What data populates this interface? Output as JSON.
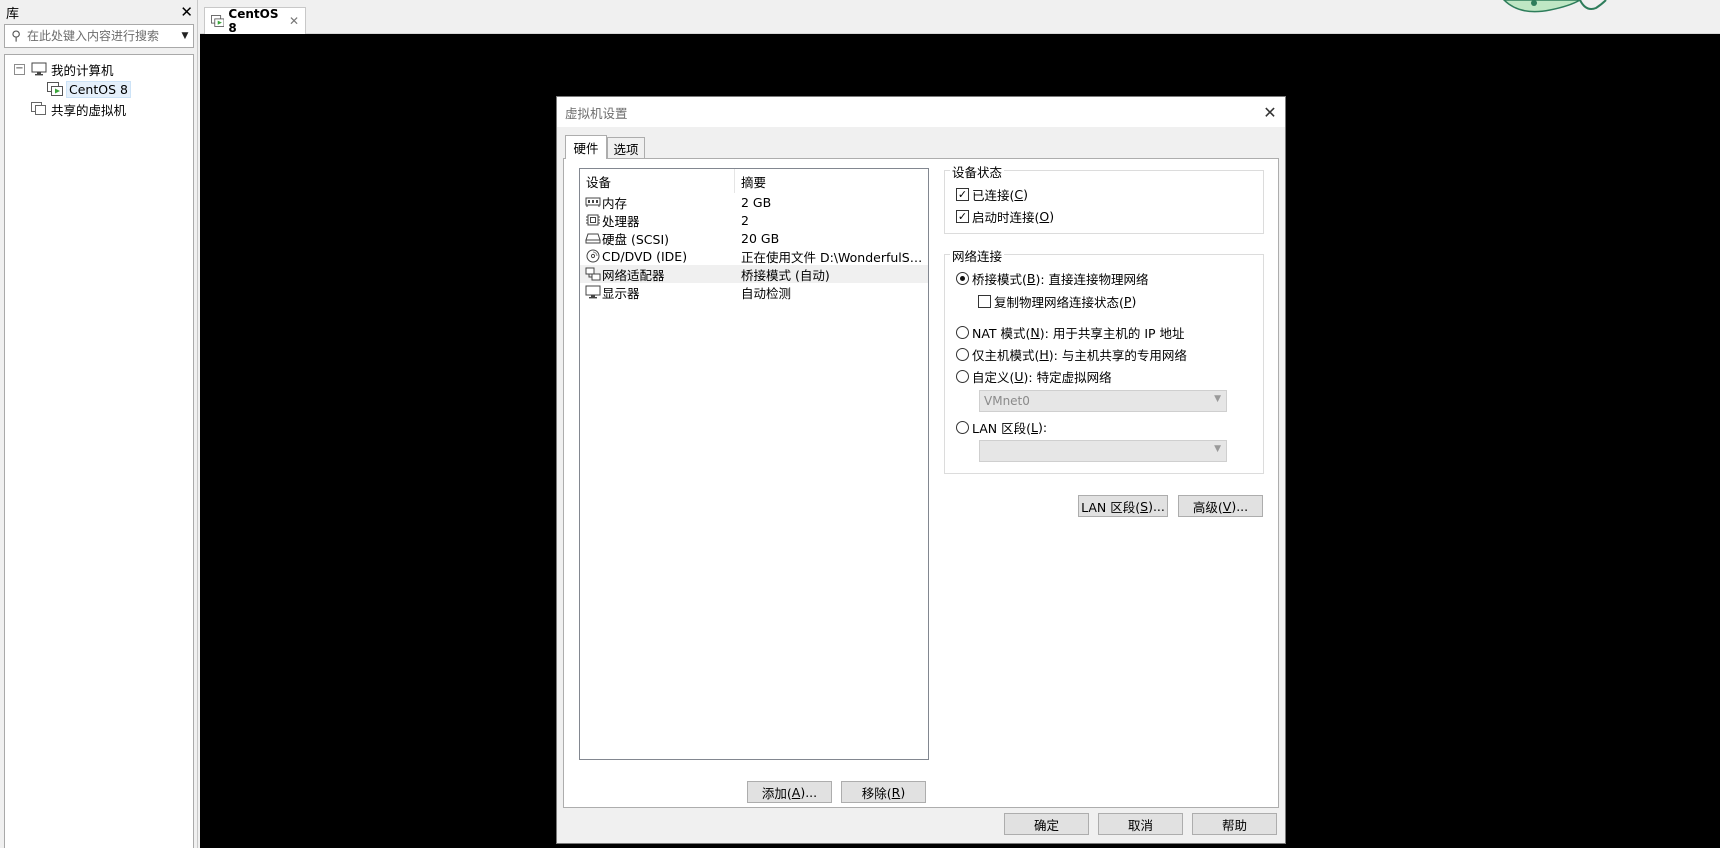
{
  "library": {
    "title": "库",
    "search_placeholder": "在此处键入内容进行搜索",
    "tree": {
      "my_computer": "我的计算机",
      "vm_name": "CentOS 8",
      "shared_vms": "共享的虚拟机"
    }
  },
  "workspace": {
    "tab_label": "CentOS 8"
  },
  "dialog": {
    "title": "虚拟机设置",
    "tabs": [
      "硬件",
      "选项"
    ],
    "device_list": {
      "col_device": "设备",
      "col_summary": "摘要",
      "rows": [
        {
          "icon": "memory-icon",
          "device": "内存",
          "summary": "2 GB"
        },
        {
          "icon": "processor-icon",
          "device": "处理器",
          "summary": "2"
        },
        {
          "icon": "hard-disk-icon",
          "device": "硬盘 (SCSI)",
          "summary": "20 GB"
        },
        {
          "icon": "cd-dvd-icon",
          "device": "CD/DVD (IDE)",
          "summary": "正在使用文件 D:\\WonderfulSof..."
        },
        {
          "icon": "network-adapter-icon",
          "device": "网络适配器",
          "summary": "桥接模式 (自动)"
        },
        {
          "icon": "display-icon",
          "device": "显示器",
          "summary": "自动检测"
        }
      ],
      "selected_index": 4
    },
    "add_button": {
      "label": "添加(",
      "mnemonic": "A",
      "suffix": ")..."
    },
    "remove_button": {
      "label": "移除(",
      "mnemonic": "R",
      "suffix": ")"
    },
    "device_status": {
      "legend": "设备状态",
      "connected": {
        "label": "已连接(",
        "mnemonic": "C",
        "suffix": ")",
        "checked": true
      },
      "connect_at_power_on": {
        "label": "启动时连接(",
        "mnemonic": "O",
        "suffix": ")",
        "checked": true
      }
    },
    "network_connection": {
      "legend": "网络连接",
      "bridged": {
        "label": "桥接模式(",
        "mnemonic": "B",
        "suffix": "): 直接连接物理网络",
        "selected": true
      },
      "replicate": {
        "label": "复制物理网络连接状态(",
        "mnemonic": "P",
        "suffix": ")",
        "checked": false
      },
      "nat": {
        "label": "NAT 模式(",
        "mnemonic": "N",
        "suffix": "): 用于共享主机的 IP 地址",
        "selected": false
      },
      "host_only": {
        "label": "仅主机模式(",
        "mnemonic": "H",
        "suffix": "): 与主机共享的专用网络",
        "selected": false
      },
      "custom": {
        "label": "自定义(",
        "mnemonic": "U",
        "suffix": "): 特定虚拟网络",
        "selected": false
      },
      "custom_value": "VMnet0",
      "lan_segment": {
        "label": "LAN 区段(",
        "mnemonic": "L",
        "suffix": "):",
        "selected": false
      },
      "lan_segment_value": ""
    },
    "lan_segments_button": {
      "label": "LAN 区段(",
      "mnemonic": "S",
      "suffix": ")..."
    },
    "advanced_button": {
      "label": "高级(",
      "mnemonic": "V",
      "suffix": ")..."
    },
    "ok_button": "确定",
    "cancel_button": "取消",
    "help_button": "帮助"
  }
}
